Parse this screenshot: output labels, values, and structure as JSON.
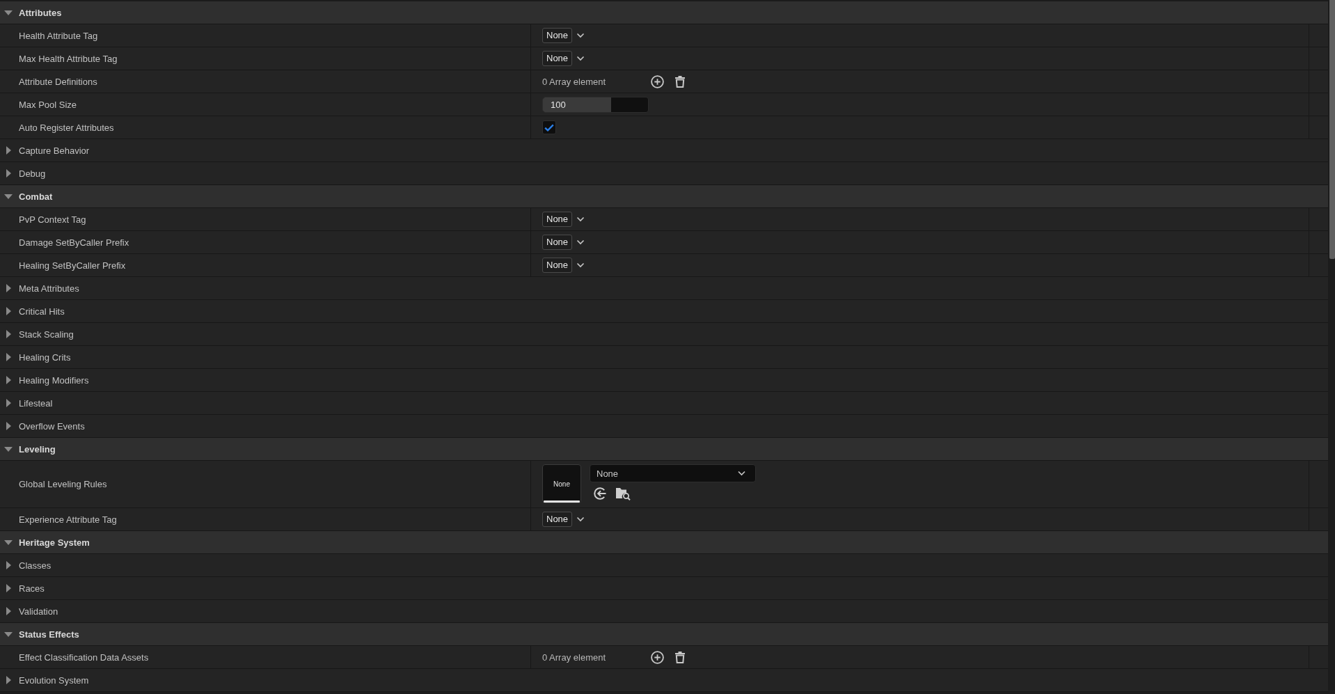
{
  "categories": [
    {
      "label": "Attributes",
      "expanded": true,
      "children": [
        {
          "kind": "tag",
          "label": "Health Attribute Tag",
          "value": "None"
        },
        {
          "kind": "tag",
          "label": "Max Health Attribute Tag",
          "value": "None"
        },
        {
          "kind": "array",
          "label": "Attribute Definitions",
          "value": "0 Array element"
        },
        {
          "kind": "number",
          "label": "Max Pool Size",
          "value": "100",
          "level": 0.65
        },
        {
          "kind": "checkbox",
          "label": "Auto Register Attributes",
          "checked": true
        },
        {
          "kind": "group",
          "label": "Capture Behavior",
          "expanded": false
        },
        {
          "kind": "group",
          "label": "Debug",
          "expanded": false
        }
      ]
    },
    {
      "label": "Combat",
      "expanded": true,
      "children": [
        {
          "kind": "tag",
          "label": "PvP Context Tag",
          "value": "None"
        },
        {
          "kind": "tag",
          "label": "Damage SetByCaller Prefix",
          "value": "None"
        },
        {
          "kind": "tag",
          "label": "Healing SetByCaller Prefix",
          "value": "None"
        },
        {
          "kind": "group",
          "label": "Meta Attributes",
          "expanded": false
        },
        {
          "kind": "group",
          "label": "Critical Hits",
          "expanded": false
        },
        {
          "kind": "group",
          "label": "Stack Scaling",
          "expanded": false
        },
        {
          "kind": "group",
          "label": "Healing Crits",
          "expanded": false
        },
        {
          "kind": "group",
          "label": "Healing Modifiers",
          "expanded": false
        },
        {
          "kind": "group",
          "label": "Lifesteal",
          "expanded": false
        },
        {
          "kind": "group",
          "label": "Overflow Events",
          "expanded": false
        }
      ]
    },
    {
      "label": "Leveling",
      "expanded": true,
      "children": [
        {
          "kind": "asset",
          "label": "Global Leveling Rules",
          "thumbnail": "None",
          "value": "None"
        },
        {
          "kind": "tag",
          "label": "Experience Attribute Tag",
          "value": "None"
        }
      ]
    },
    {
      "label": "Heritage System",
      "expanded": true,
      "children": [
        {
          "kind": "group",
          "label": "Classes",
          "expanded": false
        },
        {
          "kind": "group",
          "label": "Races",
          "expanded": false
        },
        {
          "kind": "group",
          "label": "Validation",
          "expanded": false
        }
      ]
    },
    {
      "label": "Status Effects",
      "expanded": true,
      "children": [
        {
          "kind": "array",
          "label": "Effect Classification Data Assets",
          "value": "0 Array element"
        },
        {
          "kind": "group",
          "label": "Evolution System",
          "expanded": false
        }
      ]
    }
  ]
}
